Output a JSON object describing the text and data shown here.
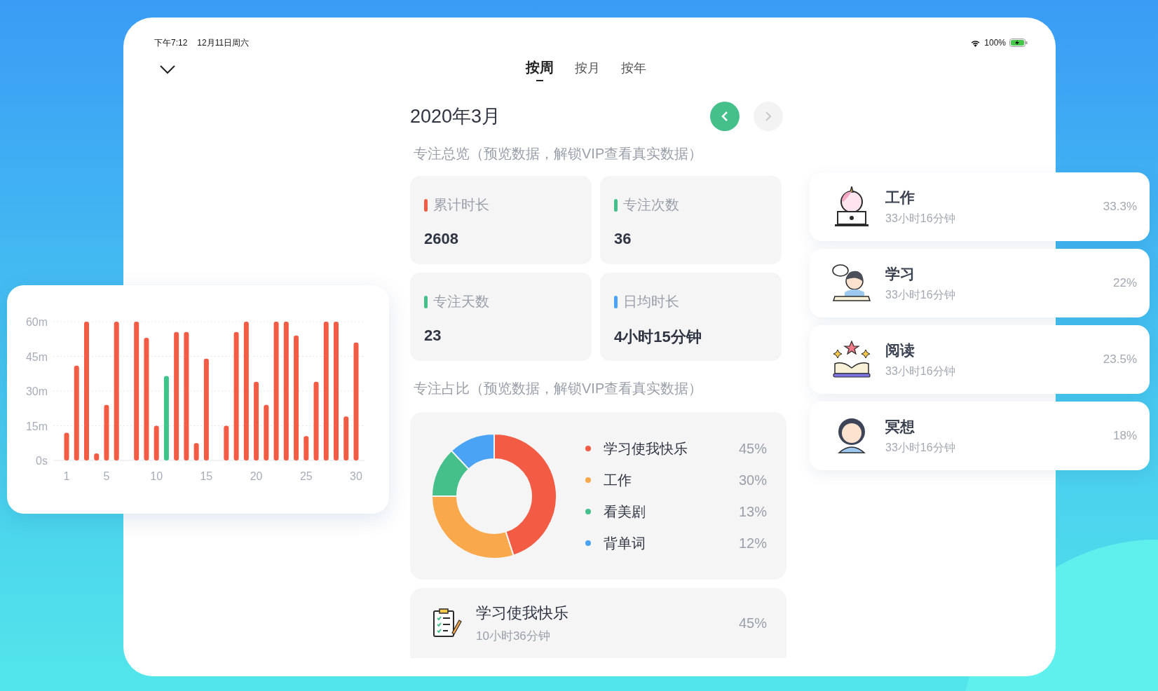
{
  "status_bar": {
    "time": "下午7:12",
    "date": "12月11日周六",
    "battery": "100%"
  },
  "tabs": [
    {
      "label": "按周",
      "selected": true
    },
    {
      "label": "按月",
      "selected": false
    },
    {
      "label": "按年",
      "selected": false
    }
  ],
  "period": {
    "title": "2020年3月",
    "prev_disabled": false,
    "next_disabled": true
  },
  "overview": {
    "title": "专注总览（预览数据，解锁VIP查看真实数据）",
    "stats": [
      {
        "label": "累计时长",
        "value": "2608",
        "color": "#f25c45"
      },
      {
        "label": "专注次数",
        "value": "36",
        "color": "#45c08a"
      },
      {
        "label": "专注天数",
        "value": "23",
        "color": "#45c08a"
      },
      {
        "label": "日均时长",
        "value": "4小时15分钟",
        "color": "#4aa3f5"
      }
    ]
  },
  "share": {
    "title": "专注占比（预览数据，解锁VIP查看真实数据）",
    "chart_data": {
      "type": "donut",
      "categories": [
        "学习使我快乐",
        "工作",
        "看美剧",
        "背单词"
      ],
      "values": [
        45,
        30,
        13,
        12
      ]
    },
    "legend": [
      {
        "percent": "45%",
        "color": "#f25c45"
      },
      {
        "percent": "30%",
        "color": "#f9a94b"
      },
      {
        "percent": "13%",
        "color": "#45c08a"
      },
      {
        "percent": "12%",
        "color": "#4aa3f5"
      }
    ],
    "items": [
      {
        "kind": "checklist",
        "title": "学习使我快乐",
        "duration": "10小时36分钟",
        "percent": "45%"
      }
    ]
  },
  "daily_chart": {
    "chart_data": {
      "type": "bar",
      "grid": true,
      "xlim": [
        1,
        30
      ],
      "x": [
        1,
        2,
        3,
        4,
        5,
        6,
        7,
        8,
        9,
        10,
        11,
        12,
        13,
        14,
        15,
        16,
        17,
        18,
        19,
        20,
        21,
        22,
        23,
        24,
        25,
        26,
        27,
        28,
        29,
        30
      ],
      "series": [
        {
          "color": "#f25c45",
          "values": [
            12,
            41,
            60,
            3,
            24,
            60,
            null,
            60,
            53,
            15,
            null,
            55.5,
            55.5,
            7.5,
            44,
            null,
            15,
            55.5,
            60,
            34,
            24,
            60,
            60,
            54,
            10.5,
            34,
            60,
            60,
            19,
            51
          ]
        },
        {
          "color": "#3ec48a",
          "values": [
            null,
            null,
            null,
            null,
            null,
            null,
            null,
            null,
            null,
            null,
            36.5,
            null,
            null,
            null,
            null,
            null,
            null,
            null,
            null,
            null,
            null,
            null,
            null,
            null,
            null,
            null,
            null,
            null,
            null,
            null
          ]
        }
      ],
      "ylim": [
        0,
        60
      ],
      "yticks": [
        {
          "value": 0,
          "label": "0s"
        },
        {
          "value": 15,
          "label": "15m"
        },
        {
          "value": 30,
          "label": "30m"
        },
        {
          "value": 45,
          "label": "45m"
        },
        {
          "value": 60,
          "label": "60m"
        }
      ],
      "xticks": [
        1,
        5,
        10,
        15,
        20,
        25,
        30
      ]
    }
  },
  "categories": [
    {
      "kind": "laptop",
      "title": "工作",
      "duration": "33小时16分钟",
      "percent": "33.3%"
    },
    {
      "kind": "reader",
      "title": "学习",
      "duration": "33小时16分钟",
      "percent": "22%"
    },
    {
      "kind": "book",
      "title": "阅读",
      "duration": "33小时16分钟",
      "percent": "23.5%"
    },
    {
      "kind": "meditate",
      "title": "冥想",
      "duration": "33小时16分钟",
      "percent": "18%"
    }
  ]
}
